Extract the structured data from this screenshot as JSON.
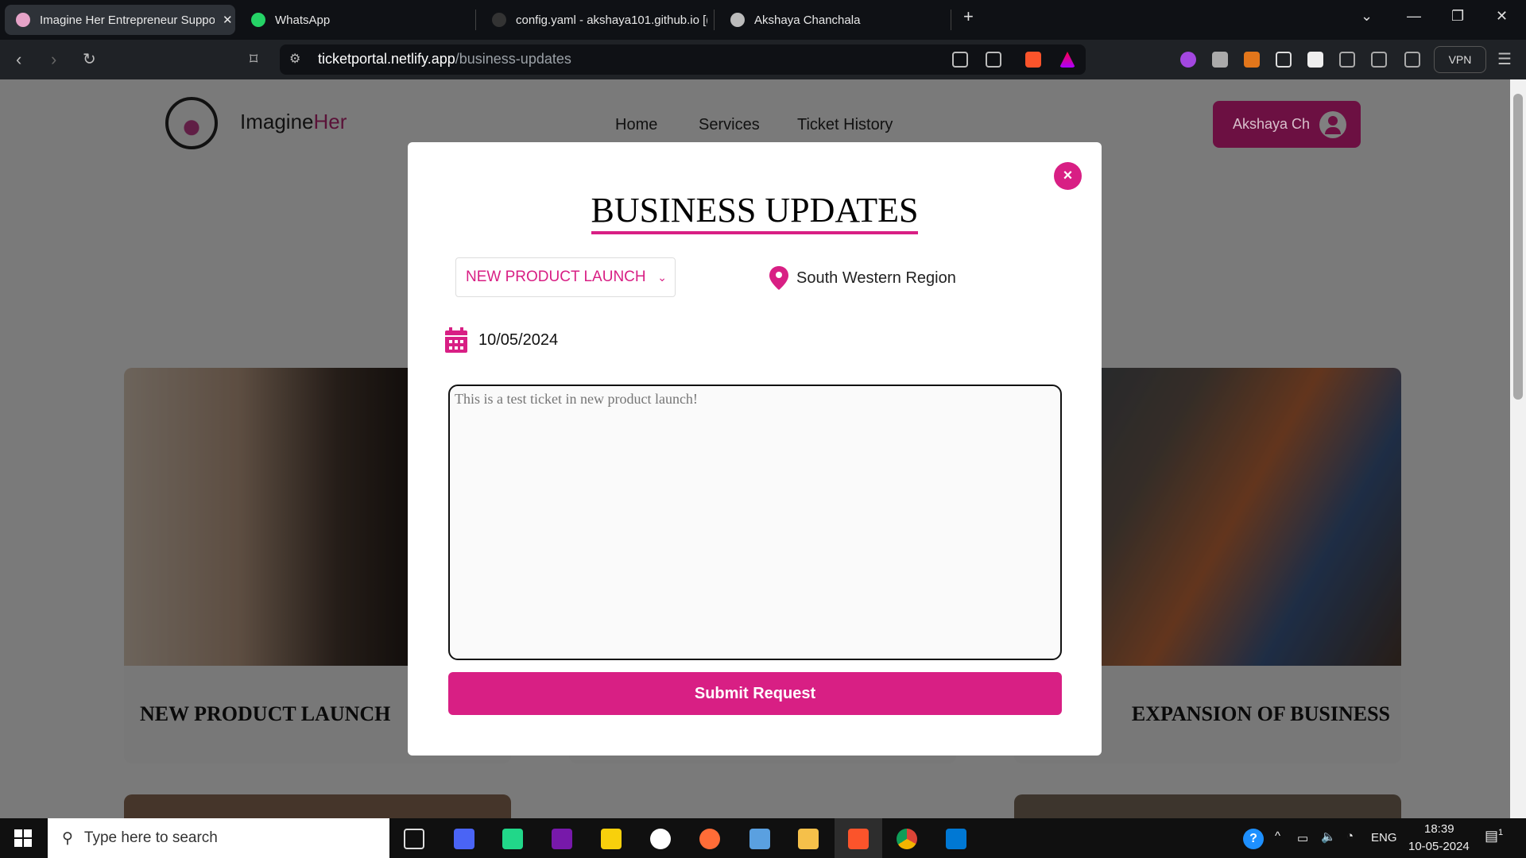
{
  "browser": {
    "tabs": [
      {
        "title": "Imagine Her Entrepreneur Suppo",
        "active": true
      },
      {
        "title": "WhatsApp"
      },
      {
        "title": "config.yaml - akshaya101.github.io [("
      },
      {
        "title": "Akshaya Chanchala"
      }
    ],
    "url_host": "ticketportal.netlify.app",
    "url_path": "/business-updates",
    "vpn_label": "VPN"
  },
  "site": {
    "brand_a": "Imagine",
    "brand_b": "Her",
    "nav": [
      "Home",
      "Services",
      "Ticket History"
    ],
    "user": "Akshaya Ch",
    "cards": [
      "NEW PRODUCT LAUNCH",
      "",
      "EXPANSION OF BUSINESS"
    ]
  },
  "modal": {
    "title": "BUSINESS UPDATES",
    "category": "NEW PRODUCT LAUNCH",
    "region": "South Western Region",
    "date": "10/05/2024",
    "ticket_text": "This is a test ticket in new product launch!",
    "submit": "Submit Request",
    "close": "×"
  },
  "colors": {
    "accent": "#d81f84"
  },
  "taskbar": {
    "search_placeholder": "Type here to search",
    "lang": "ENG",
    "time": "18:39",
    "date": "10-05-2024",
    "notifications": "1"
  }
}
